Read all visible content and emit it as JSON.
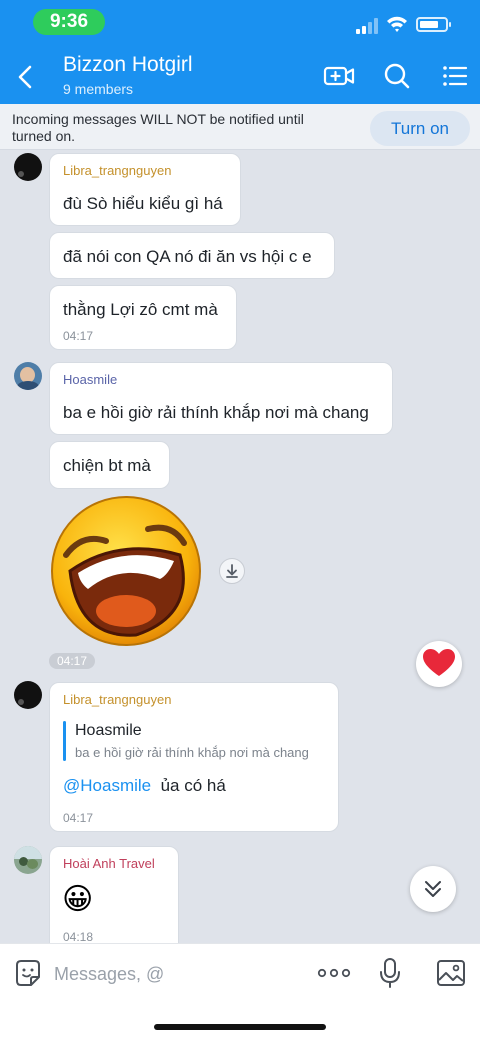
{
  "status_bar": {
    "time": "9:36"
  },
  "header": {
    "title": "Bizzon Hotgirl",
    "subtitle": "9 members"
  },
  "notice": {
    "text": "Incoming messages WILL NOT be notified until turned on.",
    "button_label": "Turn on"
  },
  "messages": {
    "m1": {
      "sender": "Libra_trangnguyen",
      "text": "đù Sò hiểu kiểu gì há"
    },
    "m2": {
      "text": "đã nói con QA nó đi ăn vs hội c e"
    },
    "m3": {
      "text": "thằng Lợi zô cmt mà",
      "time": "04:17"
    },
    "m4": {
      "sender": "Hoasmile",
      "text": "ba e hồi giờ rải thính khắp nơi mà chang"
    },
    "m5": {
      "text": "chiện bt mà"
    },
    "sticker": {
      "time": "04:17"
    },
    "m6": {
      "sender": "Libra_trangnguyen",
      "quote_name": "Hoasmile",
      "quote_text": "ba e hồi giờ rải thính khắp nơi mà chang",
      "mention": "@Hoasmile",
      "text": "ủa có há",
      "time": "04:17"
    },
    "m7": {
      "sender": "Hoài Anh Travel",
      "emoji": "😀",
      "time": "04:18"
    }
  },
  "input": {
    "placeholder": "Messages, @"
  },
  "colors": {
    "header_bg": "#1a91f0",
    "sender_libra": "#c4912c",
    "sender_hoasmile": "#5a64a8",
    "sender_hoaianh": "#c0405c",
    "mention": "#1a91f0",
    "heart": "#e8283a"
  },
  "icons": [
    "back-icon",
    "video-call-icon",
    "search-icon",
    "menu-list-icon",
    "download-icon",
    "heart-reaction-icon",
    "scroll-down-icon",
    "sticker-icon",
    "more-icon",
    "mic-icon",
    "image-icon"
  ]
}
